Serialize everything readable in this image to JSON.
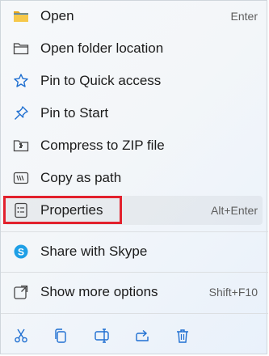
{
  "menu": {
    "items": [
      {
        "label": "Open",
        "shortcut": "Enter",
        "icon": "folder-icon"
      },
      {
        "label": "Open folder location",
        "shortcut": "",
        "icon": "folder-outline-icon"
      },
      {
        "label": "Pin to Quick access",
        "shortcut": "",
        "icon": "star-icon"
      },
      {
        "label": "Pin to Start",
        "shortcut": "",
        "icon": "pin-icon"
      },
      {
        "label": "Compress to ZIP file",
        "shortcut": "",
        "icon": "zip-folder-icon"
      },
      {
        "label": "Copy as path",
        "shortcut": "",
        "icon": "copy-path-icon"
      },
      {
        "label": "Properties",
        "shortcut": "Alt+Enter",
        "icon": "properties-icon"
      },
      {
        "label": "Share with Skype",
        "shortcut": "",
        "icon": "skype-icon"
      },
      {
        "label": "Show more options",
        "shortcut": "Shift+F10",
        "icon": "more-options-icon"
      }
    ]
  },
  "toolbar": {
    "buttons": [
      "cut-icon",
      "copy-icon",
      "rename-icon",
      "share-icon",
      "delete-icon"
    ]
  },
  "colors": {
    "accent": "#0067c0",
    "highlight_border": "#e2212d",
    "folder_yellow": "#f4c542",
    "skype_blue": "#1e9fe6"
  }
}
